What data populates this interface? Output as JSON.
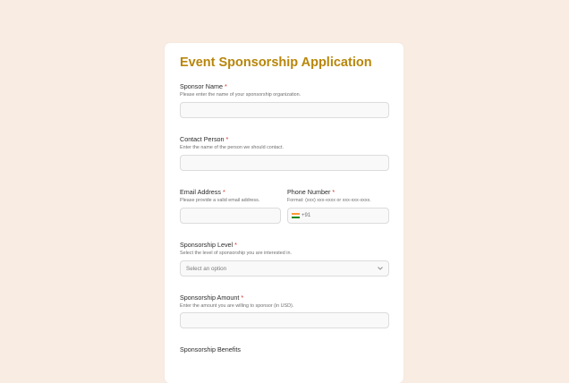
{
  "form": {
    "title": "Event Sponsorship Application",
    "fields": {
      "sponsor_name": {
        "label": "Sponsor Name",
        "required": "*",
        "hint": "Please enter the name of your sponsorship organization.",
        "value": ""
      },
      "contact_person": {
        "label": "Contact Person",
        "required": "*",
        "hint": "Enter the name of the person we should contact.",
        "value": ""
      },
      "email": {
        "label": "Email Address",
        "required": "*",
        "hint": "Please provide a valid email address.",
        "value": ""
      },
      "phone": {
        "label": "Phone Number",
        "required": "*",
        "hint": "Format: (xxx) xxx-xxxx or xxx-xxx-xxxx.",
        "country_code": "+91",
        "country_flag_icon": "india-flag-icon",
        "value": ""
      },
      "sponsorship_level": {
        "label": "Sponsorship Level",
        "required": "*",
        "hint": "Select the level of sponsorship you are interested in.",
        "placeholder": "Select an option"
      },
      "sponsorship_amount": {
        "label": "Sponsorship Amount",
        "required": "*",
        "hint": "Enter the amount you are willing to sponsor (in USD).",
        "value": ""
      },
      "sponsorship_benefits": {
        "label": "Sponsorship Benefits"
      }
    }
  },
  "colors": {
    "page_background": "#f9ede3",
    "title": "#b8860b",
    "required_marker": "#d93025"
  }
}
